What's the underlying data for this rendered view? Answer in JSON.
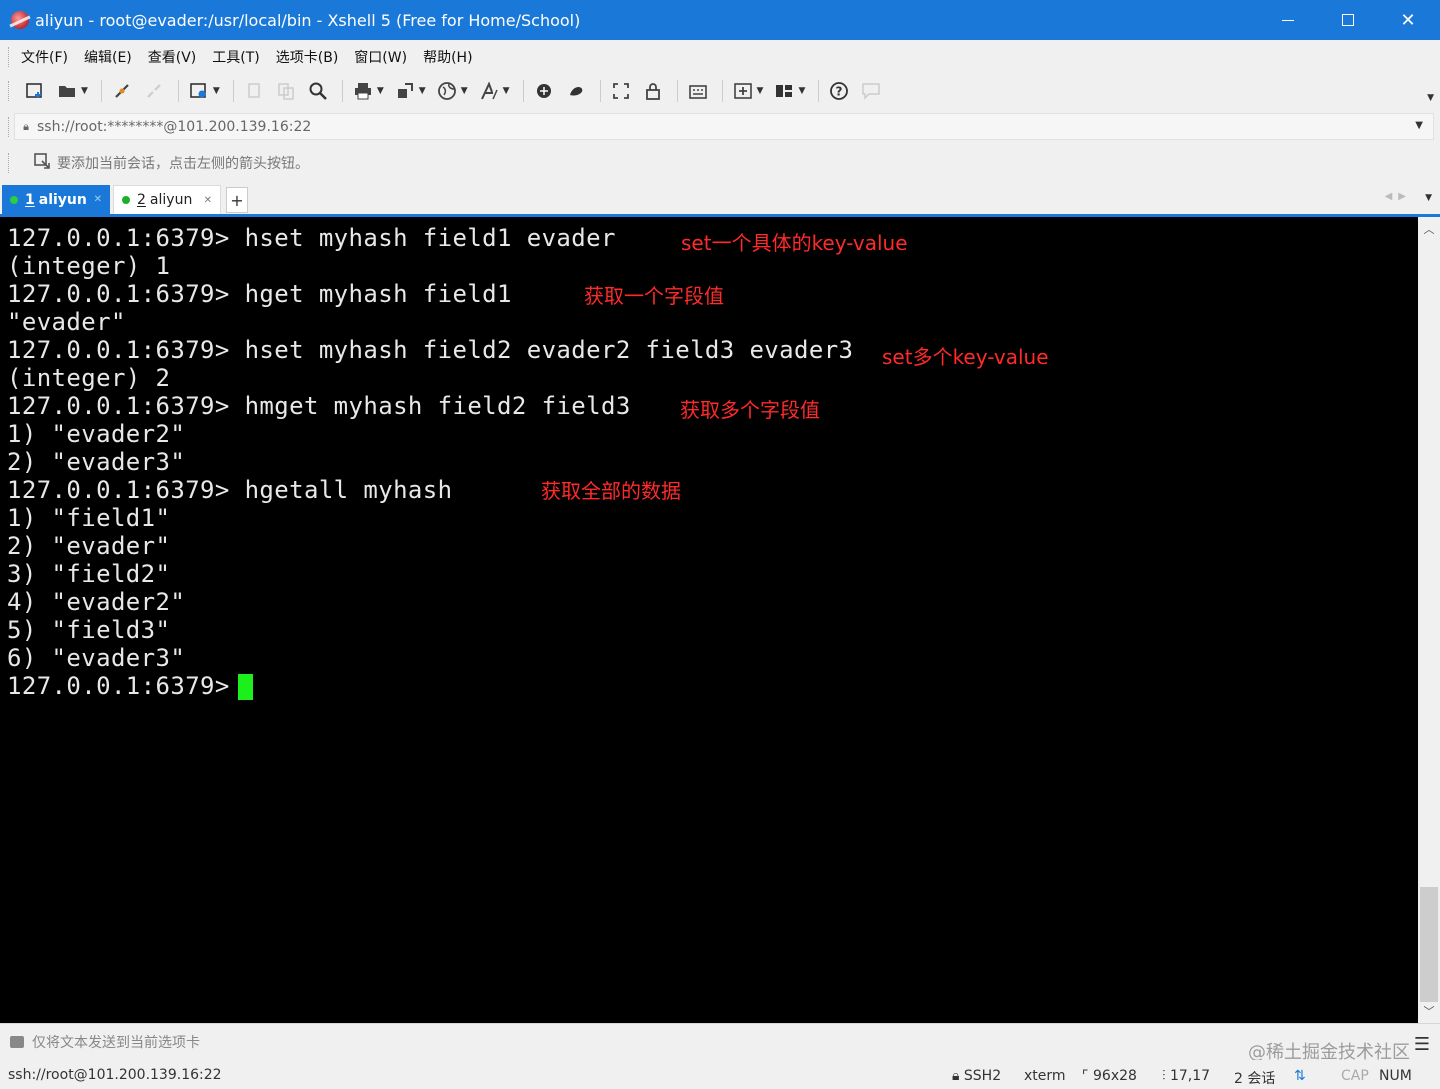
{
  "window": {
    "title": "aliyun - root@evader:/usr/local/bin - Xshell 5 (Free for Home/School)"
  },
  "menu": [
    "文件(F)",
    "编辑(E)",
    "查看(V)",
    "工具(T)",
    "选项卡(B)",
    "窗口(W)",
    "帮助(H)"
  ],
  "toolbar": {
    "icons": [
      "new-session-icon",
      "open-folder-icon",
      "connect-icon",
      "disconnect-icon",
      "properties-icon",
      "copy-icon",
      "paste-icon",
      "find-icon",
      "print-icon",
      "transfer-icon",
      "globe-icon",
      "font-icon",
      "xftp-icon",
      "xmanager-icon",
      "fullscreen-icon",
      "lock-icon",
      "keyboard-icon",
      "add-tab-icon",
      "layout-icon",
      "help-icon",
      "chat-icon"
    ]
  },
  "address": {
    "value": "ssh://root:********@101.200.139.16:22"
  },
  "quickbar": {
    "hint": "要添加当前会话，点击左侧的箭头按钮。"
  },
  "tabs": [
    {
      "number": "1",
      "label": "aliyun",
      "active": true
    },
    {
      "number": "2",
      "label": "aliyun",
      "active": false
    }
  ],
  "tab_add": "+",
  "terminal": {
    "lines": [
      "127.0.0.1:6379> hset myhash field1 evader",
      "(integer) 1",
      "127.0.0.1:6379> hget myhash field1",
      "\"evader\"",
      "127.0.0.1:6379> hset myhash field2 evader2 field3 evader3",
      "(integer) 2",
      "127.0.0.1:6379> hmget myhash field2 field3",
      "1) \"evader2\"",
      "2) \"evader3\"",
      "127.0.0.1:6379> hgetall myhash",
      "1) \"field1\"",
      "2) \"evader\"",
      "3) \"field2\"",
      "4) \"evader2\"",
      "5) \"field3\"",
      "6) \"evader3\"",
      "127.0.0.1:6379> "
    ],
    "annotations": [
      "set一个具体的key-value",
      "获取一个字段值",
      "set多个key-value",
      "获取多个字段值",
      "获取全部的数据"
    ],
    "annotation_color": "#ff2a2a",
    "cursor_color": "#1cf01c"
  },
  "compose": {
    "text": "仅将文本发送到当前选项卡",
    "watermark": "@稀土掘金技术社区"
  },
  "status": {
    "connection": "ssh://root@101.200.139.16:22",
    "protocol": "SSH2",
    "terminal_type": "xterm",
    "size": "96x28",
    "cursor_pos": "17,17",
    "sessions": "2 会话",
    "caps": "CAP",
    "num": "NUM"
  },
  "colors": {
    "accent": "#1a79d8",
    "terminal_bg": "#000000",
    "terminal_fg": "#e8e8e8"
  }
}
